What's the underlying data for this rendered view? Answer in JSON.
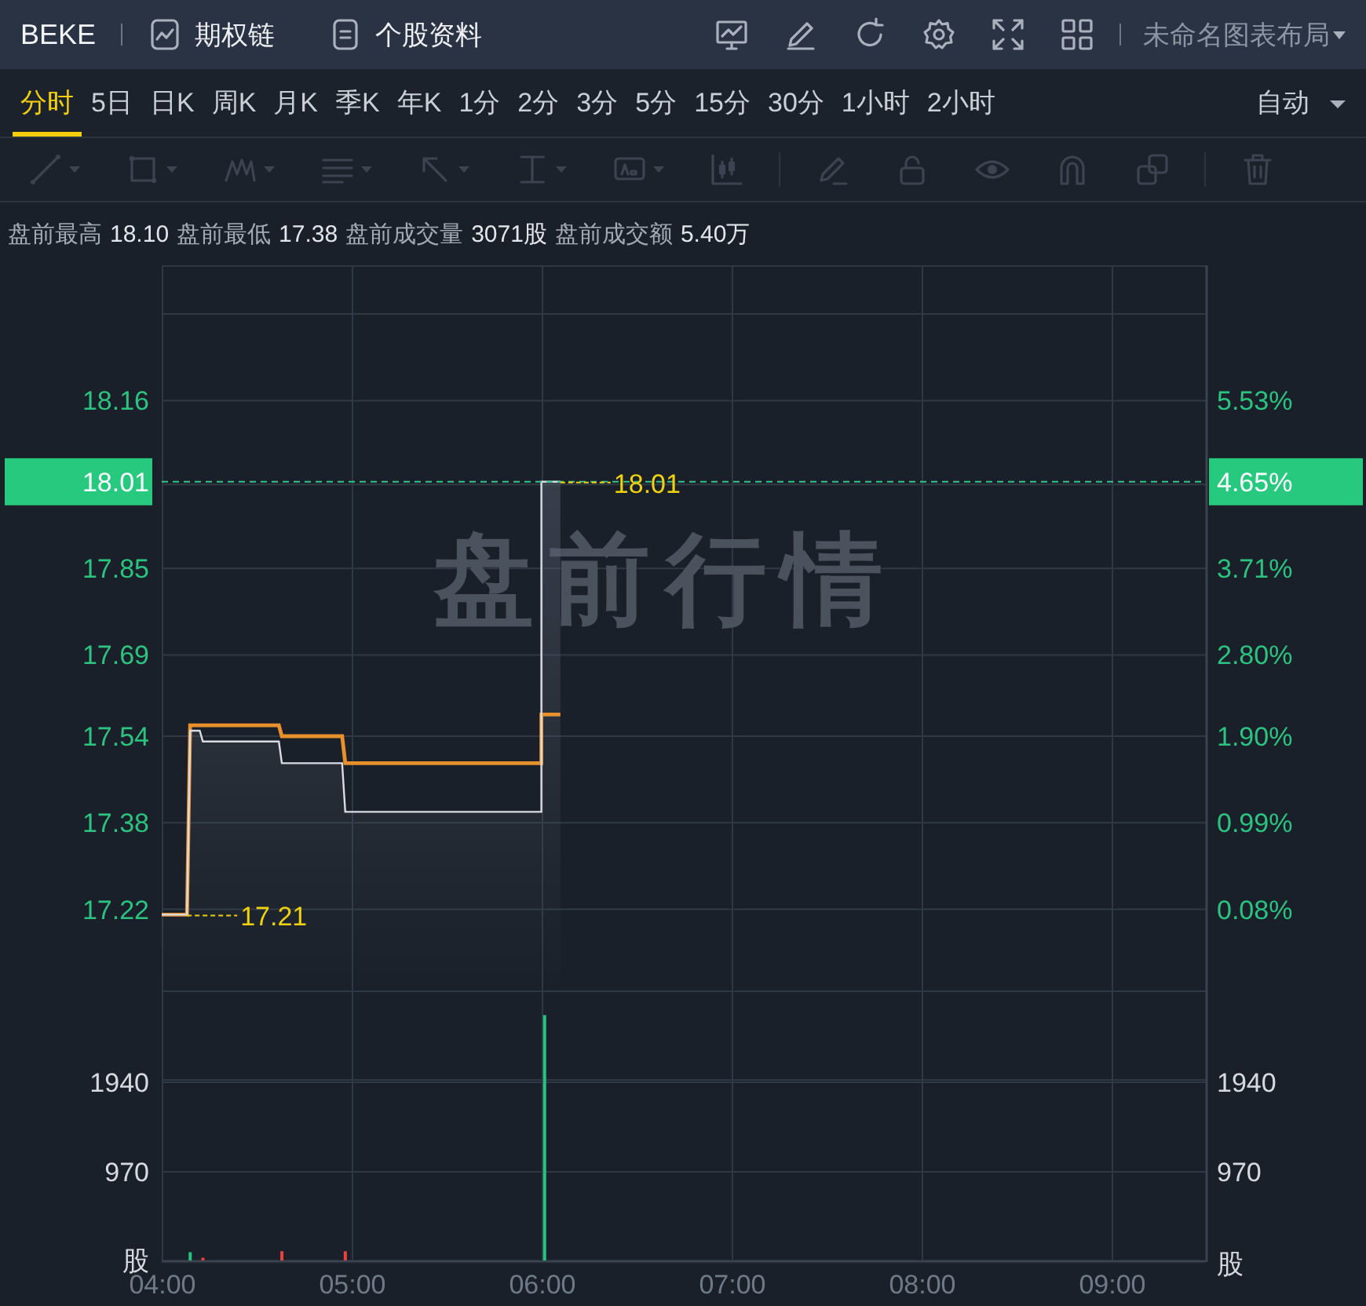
{
  "header": {
    "symbol": "BEKE",
    "links": [
      {
        "label": "期权链"
      },
      {
        "label": "个股资料"
      }
    ],
    "layout_name": "未命名图表布局"
  },
  "periods": [
    {
      "label": "分时",
      "selected": true
    },
    {
      "label": "5日",
      "selected": false
    },
    {
      "label": "日K",
      "selected": false
    },
    {
      "label": "周K",
      "selected": false
    },
    {
      "label": "月K",
      "selected": false
    },
    {
      "label": "季K",
      "selected": false
    },
    {
      "label": "年K",
      "selected": false
    },
    {
      "label": "1分",
      "selected": false
    },
    {
      "label": "2分",
      "selected": false
    },
    {
      "label": "3分",
      "selected": false
    },
    {
      "label": "5分",
      "selected": false
    },
    {
      "label": "15分",
      "selected": false
    },
    {
      "label": "30分",
      "selected": false
    },
    {
      "label": "1小时",
      "selected": false
    },
    {
      "label": "2小时",
      "selected": false
    }
  ],
  "mode_select": {
    "value": "自动"
  },
  "drawing_tools": {
    "disabled": true
  },
  "premarket_stats": [
    {
      "label": "盘前最高",
      "value": "18.10"
    },
    {
      "label": "盘前最低",
      "value": "17.38"
    },
    {
      "label": "盘前成交量",
      "value": "3071股"
    },
    {
      "label": "盘前成交额",
      "value": "5.40万"
    }
  ],
  "price_panel": {
    "session_label": "盘前行情",
    "right_axis": [
      "5.53%",
      "3.71%",
      "2.80%",
      "1.90%",
      "0.99%",
      "0.08%"
    ],
    "last_price": {
      "price_label": "18.01",
      "change_label": "4.65%"
    },
    "chart_data": {
      "type": "line",
      "x": [
        4.0,
        4.133,
        4.15,
        4.2,
        4.217,
        4.617,
        4.633,
        4.95,
        4.967,
        6.0,
        6.0,
        6.1
      ],
      "series": [
        {
          "color": "#d9dde3",
          "values": [
            17.21,
            17.21,
            17.55,
            17.55,
            17.53,
            17.53,
            17.49,
            17.49,
            17.4,
            17.4,
            18.01,
            18.01
          ]
        },
        {
          "color": "#e8902c",
          "values": [
            17.21,
            17.21,
            17.56,
            17.56,
            17.56,
            17.56,
            17.54,
            17.54,
            17.49,
            17.49,
            17.58,
            17.58
          ]
        }
      ],
      "xlim": [
        4.0,
        9.5
      ],
      "ylim": [
        17.07,
        18.41
      ],
      "grid": true,
      "ref_lines": [
        {
          "axis": "y",
          "value": 18.01,
          "color": "#36c48a"
        }
      ],
      "yticks": [
        {
          "value": 18.16,
          "label": "18.16"
        },
        {
          "value": 17.85,
          "label": "17.85"
        },
        {
          "value": 17.69,
          "label": "17.69"
        },
        {
          "value": 17.54,
          "label": "17.54"
        },
        {
          "value": 17.38,
          "label": "17.38"
        },
        {
          "value": 17.22,
          "label": "17.22"
        }
      ],
      "annotations": [
        {
          "x": 6.1,
          "y": 18.01,
          "text": "18.01"
        },
        {
          "x": 4.133,
          "y": 17.21,
          "text": "17.21"
        }
      ]
    }
  },
  "volume_panel": {
    "unit_labels": [
      "股",
      "股"
    ],
    "chart_data": {
      "type": "bar",
      "x": [
        4.15,
        4.217,
        4.633,
        4.967,
        6.017
      ],
      "series": [
        {
          "color": "#27c27d",
          "values": [
            90,
            null,
            null,
            null,
            2660
          ]
        },
        {
          "color": "#e8413f",
          "values": [
            null,
            30,
            100,
            100,
            null
          ]
        }
      ],
      "xlim": [
        4.0,
        9.5
      ],
      "ylim": [
        0,
        2927
      ],
      "grid": true,
      "xticks": [
        {
          "value": 4,
          "label": "04:00"
        },
        {
          "value": 5,
          "label": "05:00"
        },
        {
          "value": 6,
          "label": "06:00"
        },
        {
          "value": 7,
          "label": "07:00"
        },
        {
          "value": 8,
          "label": "08:00"
        },
        {
          "value": 9,
          "label": "09:00"
        }
      ],
      "yticks": [
        {
          "value": 970,
          "label": "970"
        },
        {
          "value": 1940,
          "label": "1940"
        }
      ]
    }
  }
}
